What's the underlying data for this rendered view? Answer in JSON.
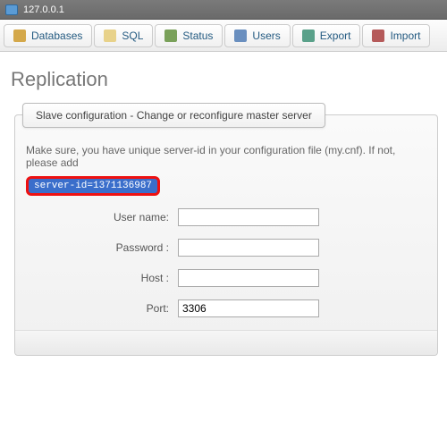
{
  "topbar": {
    "host": "127.0.0.1"
  },
  "toolbar": {
    "databases": "Databases",
    "sql": "SQL",
    "status": "Status",
    "users": "Users",
    "export": "Export",
    "import": "Import"
  },
  "page": {
    "title": "Replication"
  },
  "panel": {
    "tab_label": "Slave configuration - Change or reconfigure master server",
    "note": "Make sure, you have unique server-id in your configuration file (my.cnf). If not, please add",
    "server_id_line": "server-id=1371136987"
  },
  "form": {
    "username_label": "User name:",
    "username_value": "",
    "password_label": "Password :",
    "password_value": "",
    "host_label": "Host :",
    "host_value": "",
    "port_label": "Port:",
    "port_value": "3306"
  }
}
